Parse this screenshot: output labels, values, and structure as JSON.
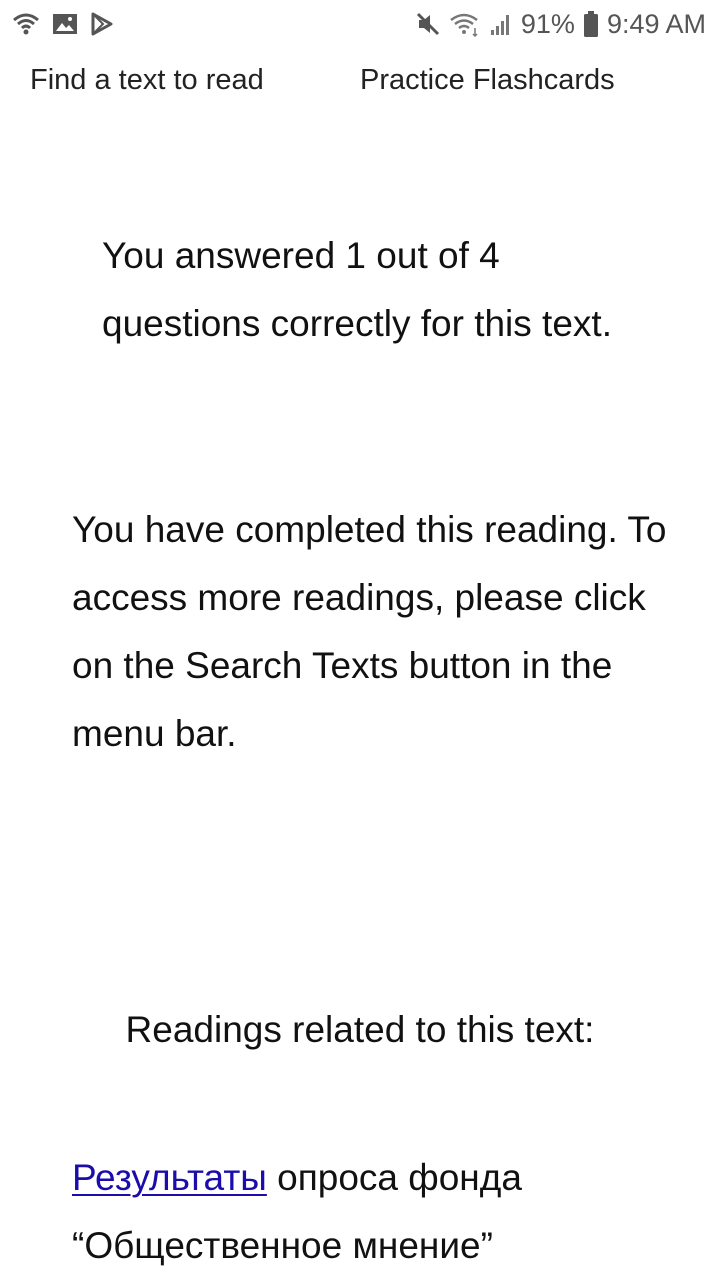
{
  "status_bar": {
    "battery_percent": "91%",
    "time": "9:49 AM",
    "icons_left": [
      "wifi-calling-icon",
      "image-icon",
      "play-store-icon"
    ],
    "icons_right": [
      "mute-icon",
      "wifi-icon",
      "signal-icon",
      "battery-icon"
    ]
  },
  "menu": {
    "find_text": "Find a text to read",
    "flashcards": "Practice Flashcards"
  },
  "result": {
    "message": "You answered 1 out of 4 questions correctly for this text."
  },
  "completion": {
    "message": "You have completed this reading. To access more readings, please click on the Search Texts button in the menu bar."
  },
  "related": {
    "heading": "Readings related to this text:",
    "items": [
      {
        "link_text": "Результаты",
        "rest_text": " опроса фонда “Общественное мнение”"
      }
    ]
  }
}
